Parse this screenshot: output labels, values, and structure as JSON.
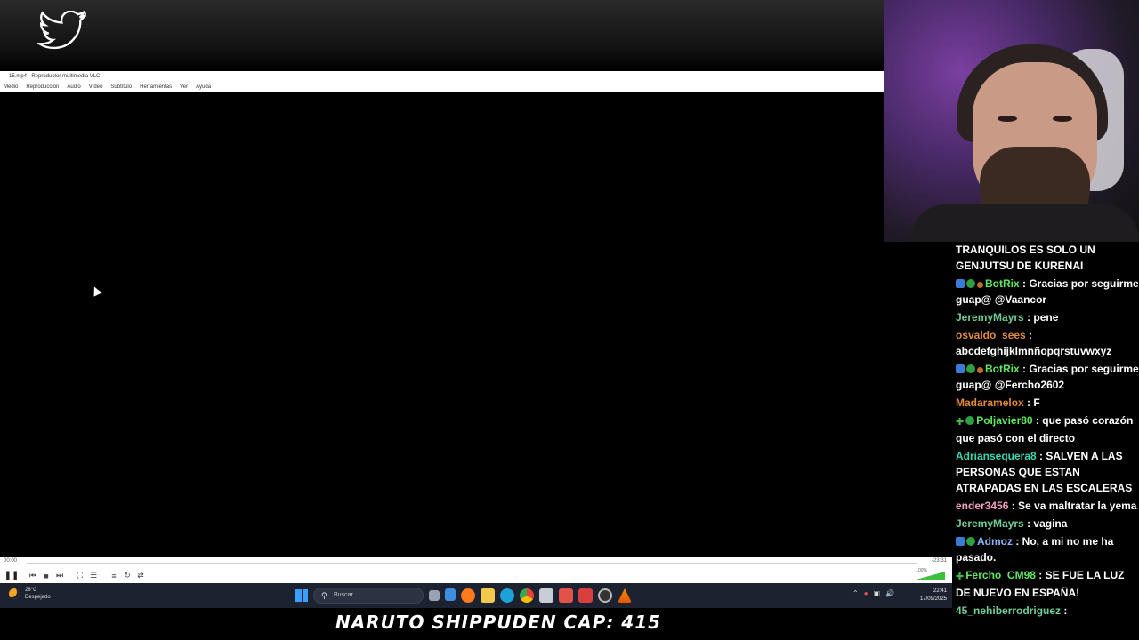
{
  "overlay": {
    "twitter_icon": "twitter-bird-icon"
  },
  "vlc": {
    "window_title": "15.mp4 - Reproductor multimedia VLC",
    "menu": [
      "Medio",
      "Reproducción",
      "Audio",
      "Vídeo",
      "Subtítulo",
      "Herramientas",
      "Ver",
      "Ayuda"
    ],
    "time_elapsed": "00:00",
    "time_remaining": "-23:31",
    "progress_fraction": 0.0,
    "volume_label": "100%",
    "volume_fraction": 1.0
  },
  "taskbar": {
    "weather_temp": "28°C",
    "weather_desc": "Despejado",
    "search_placeholder": "Buscar",
    "time": "22:41",
    "date": "17/09/2025"
  },
  "episode_title": "NARUTO SHIPPUDEN CAP: 415",
  "chat": {
    "messages": [
      {
        "user": "",
        "text": "TRANQUILOS ES SOLO UN GENJUTSU DE KURENAI",
        "color": "#ffffff",
        "badges": []
      },
      {
        "user": "BotRix",
        "text": "Gracias por seguirme guap@ @Vaancor",
        "color": "#5ee65e",
        "badges": [
          "blue",
          "green",
          "orange"
        ]
      },
      {
        "user": "JeremyMayrs",
        "text": "pene",
        "color": "#6fcf97",
        "badges": []
      },
      {
        "user": "osvaldo_sees",
        "text": "abcdefghijklmnñopqrstuvwxyz",
        "color": "#e08a3a",
        "badges": []
      },
      {
        "user": "BotRix",
        "text": "Gracias por seguirme guap@ @Fercho2602",
        "color": "#5ee65e",
        "badges": [
          "blue",
          "green",
          "orange"
        ]
      },
      {
        "user": "Madaramelox",
        "text": "F",
        "color": "#e08a3a",
        "badges": []
      },
      {
        "user": "Poljavier80",
        "text": "que pasó corazón que pasó con el directo",
        "color": "#5ee65e",
        "badges": [
          "plus",
          "green"
        ]
      },
      {
        "user": "Adriansequera8",
        "text": "SALVEN A LAS PERSONAS QUE ESTAN ATRAPADAS EN LAS ESCALERAS",
        "color": "#3ad6b0",
        "badges": []
      },
      {
        "user": "ender3456",
        "text": "Se va maltratar la yema",
        "color": "#f2a0c0",
        "badges": []
      },
      {
        "user": "JeremyMayrs",
        "text": "vagina",
        "color": "#6fcf97",
        "badges": []
      },
      {
        "user": "Admoz",
        "text": "No, a mi no me ha pasado.",
        "color": "#8ab4f8",
        "badges": [
          "blue",
          "green"
        ]
      },
      {
        "user": "Fercho_CM98",
        "text": "SE FUE LA LUZ DE NUEVO EN ESPAÑA!",
        "color": "#5ee65e",
        "badges": [
          "plus"
        ]
      },
      {
        "user": "45_nehiberrodriguez",
        "text": "",
        "color": "#6fcf97",
        "badges": []
      }
    ]
  }
}
